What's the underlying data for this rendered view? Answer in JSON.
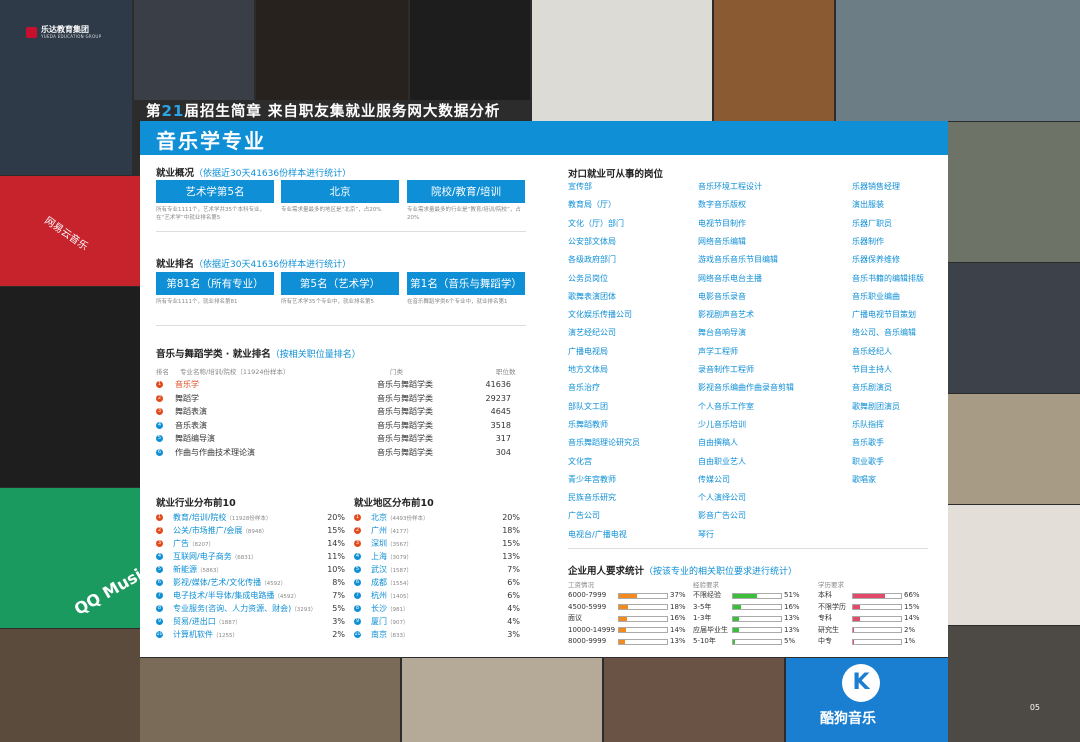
{
  "brand": {
    "name": "乐达教育集团",
    "sub": "YUEDA EDUCATION GROUP"
  },
  "headline": {
    "prefix": "第",
    "issue": "21",
    "suffix": "届招生简章   来自职友集就业服务网大数据分析"
  },
  "title": "音乐学专业",
  "overview": {
    "title": "就业概况",
    "note": "（依据近30天41636份样本进行统计）",
    "boxes": [
      {
        "label": "艺术学第5名",
        "note": "所有专业1111个，艺术学共35个本科专业，在“艺术学”中就业排名第5"
      },
      {
        "label": "北京",
        "note": "专业需求量最多的地区是“北京”，占20%"
      },
      {
        "label": "院校/教育/培训",
        "note": "专业需求量最多的行业是“教育/培训/院校”，占20%"
      }
    ]
  },
  "ranking": {
    "title": "就业排名",
    "note": "（依据近30天41636份样本进行统计）",
    "boxes": [
      {
        "label": "第81名（所有专业）",
        "note": "所有专业1111个，就业排名第81"
      },
      {
        "label": "第5名（艺术学）",
        "note": "所有艺术学35个专业中，就业排名第5"
      },
      {
        "label": "第1名（音乐与舞蹈学）",
        "note": "在音乐舞蹈学类6个专业中，就业排名第1"
      }
    ]
  },
  "category": {
    "title": "音乐与舞蹈学类 · 就业排名",
    "note": "（按相关职位量排名）",
    "col_rank": "排名",
    "col_name": "专业名称/培训/院校（11924份样本）",
    "col_type": "门类",
    "col_count": "职位数",
    "rows": [
      {
        "rank": "1",
        "name": "音乐学",
        "type": "音乐与舞蹈学类",
        "count": "41636"
      },
      {
        "rank": "2",
        "name": "舞蹈学",
        "type": "音乐与舞蹈学类",
        "count": "29237"
      },
      {
        "rank": "3",
        "name": "舞蹈表演",
        "type": "音乐与舞蹈学类",
        "count": "4645"
      },
      {
        "rank": "4",
        "name": "音乐表演",
        "type": "音乐与舞蹈学类",
        "count": "3518"
      },
      {
        "rank": "5",
        "name": "舞蹈编导演",
        "type": "音乐与舞蹈学类",
        "count": "317"
      },
      {
        "rank": "6",
        "name": "作曲与作曲技术理论演",
        "type": "音乐与舞蹈学类",
        "count": "304"
      }
    ]
  },
  "industry": {
    "title": "就业行业分布前10",
    "rows": [
      {
        "rank": "1",
        "name": "教育/培训/院校",
        "sub": "（11928份样本）",
        "pct": "20%"
      },
      {
        "rank": "2",
        "name": "公关/市场推广/会展",
        "sub": "（8948）",
        "pct": "15%"
      },
      {
        "rank": "3",
        "name": "广告",
        "sub": "（8207）",
        "pct": "14%"
      },
      {
        "rank": "4",
        "name": "互联网/电子商务",
        "sub": "（6831）",
        "pct": "11%"
      },
      {
        "rank": "5",
        "name": "新能源",
        "sub": "（5863）",
        "pct": "10%"
      },
      {
        "rank": "6",
        "name": "影视/媒体/艺术/文化传播",
        "sub": "（4592）",
        "pct": "8%"
      },
      {
        "rank": "7",
        "name": "电子技术/半导体/集成电路播",
        "sub": "（4592）",
        "pct": "7%"
      },
      {
        "rank": "8",
        "name": "专业服务(咨询、人力资源、财会)",
        "sub": "（3293）",
        "pct": "5%"
      },
      {
        "rank": "9",
        "name": "贸易/进出口",
        "sub": "（1887）",
        "pct": "3%"
      },
      {
        "rank": "10",
        "name": "计算机软件",
        "sub": "（1255）",
        "pct": "2%"
      }
    ]
  },
  "region": {
    "title": "就业地区分布前10",
    "rows": [
      {
        "rank": "1",
        "name": "北京",
        "sub": "（4493份样本）",
        "pct": "20%"
      },
      {
        "rank": "2",
        "name": "广州",
        "sub": "（4177）",
        "pct": "18%"
      },
      {
        "rank": "3",
        "name": "深圳",
        "sub": "（3567）",
        "pct": "15%"
      },
      {
        "rank": "4",
        "name": "上海",
        "sub": "（3079）",
        "pct": "13%"
      },
      {
        "rank": "5",
        "name": "武汉",
        "sub": "（1587）",
        "pct": "7%"
      },
      {
        "rank": "6",
        "name": "成都",
        "sub": "（1554）",
        "pct": "6%"
      },
      {
        "rank": "7",
        "name": "杭州",
        "sub": "（1405）",
        "pct": "6%"
      },
      {
        "rank": "8",
        "name": "长沙",
        "sub": "（981）",
        "pct": "4%"
      },
      {
        "rank": "9",
        "name": "厦门",
        "sub": "（907）",
        "pct": "4%"
      },
      {
        "rank": "10",
        "name": "南京",
        "sub": "（833）",
        "pct": "3%"
      }
    ]
  },
  "jobs": {
    "title": "对口就业可从事的岗位",
    "col1": [
      "宣传部",
      "教育局（厅）",
      "文化（厅）部门",
      "公安部文体局",
      "各级政府部门",
      "公务员岗位",
      "歌舞表演团体",
      "文化娱乐传播公司",
      "演艺经纪公司",
      "广播电视局",
      "地方文体局",
      "音乐治疗",
      "部队文工团",
      "乐舞蹈教师",
      "音乐舞蹈理论研究员",
      "文化宫",
      "青少年宫教师",
      "民族音乐研究",
      "广告公司",
      "电视台/广播电视"
    ],
    "col2": [
      "音乐环境工程设计",
      "数字音乐版权",
      "电视节目制作",
      "网络音乐编辑",
      "游戏音乐音乐节目编辑",
      "网络音乐电台主播",
      "电影音乐录音",
      "影视剧声音艺术",
      "舞台音响导演",
      "声学工程师",
      "录音制作工程师",
      "影视音乐编曲作曲录音剪辑",
      "个人音乐工作室",
      "少儿音乐培训",
      "自由撰稿人",
      "自由职业艺人",
      "传媒公司",
      "个人演绎公司",
      "影音广告公司",
      "琴行"
    ],
    "col3": [
      "乐器销售经理",
      "演出服装",
      "乐器厂职员",
      "乐器制作",
      "乐器保养维修",
      "音乐书籍的编辑排版",
      "音乐职业编曲",
      "广播电视节目策划",
      "络公司、音乐编辑",
      "音乐经纪人",
      "节目主持人",
      "音乐剧演员",
      "歌舞剧团演员",
      "乐队指挥",
      "音乐歌手",
      "职业歌手",
      "歌唱家"
    ]
  },
  "requirements": {
    "title": "企业用人要求统计",
    "note": "（按该专业的相关职位要求进行统计）",
    "salary": {
      "head": "工资情况",
      "rows": [
        {
          "label": "6000-7999",
          "value": 37,
          "pct": "37%"
        },
        {
          "label": "4500-5999",
          "value": 18,
          "pct": "18%"
        },
        {
          "label": "面议",
          "value": 16,
          "pct": "16%"
        },
        {
          "label": "10000-14999",
          "value": 14,
          "pct": "14%"
        },
        {
          "label": "8000-9999",
          "value": 13,
          "pct": "13%"
        }
      ]
    },
    "experience": {
      "head": "经验要求",
      "rows": [
        {
          "label": "不限经验",
          "value": 51,
          "pct": "51%"
        },
        {
          "label": "3-5年",
          "value": 16,
          "pct": "16%"
        },
        {
          "label": "1-3年",
          "value": 13,
          "pct": "13%"
        },
        {
          "label": "应届毕业生",
          "value": 13,
          "pct": "13%"
        },
        {
          "label": "5-10年",
          "value": 5,
          "pct": "5%"
        }
      ]
    },
    "education": {
      "head": "学历要求",
      "rows": [
        {
          "label": "本科",
          "value": 66,
          "pct": "66%"
        },
        {
          "label": "不限学历",
          "value": 15,
          "pct": "15%"
        },
        {
          "label": "专科",
          "value": 14,
          "pct": "14%"
        },
        {
          "label": "研究生",
          "value": 2,
          "pct": "2%"
        },
        {
          "label": "中专",
          "value": 1,
          "pct": "1%"
        }
      ]
    },
    "colors": {
      "salary": "#f28a1f",
      "experience": "#3bbf3b",
      "education": "#e24a6a"
    }
  },
  "background_logos": {
    "netease": "网易云音乐",
    "qq": "QQ Music",
    "kugou": "酷狗音乐"
  },
  "page_number": "05"
}
